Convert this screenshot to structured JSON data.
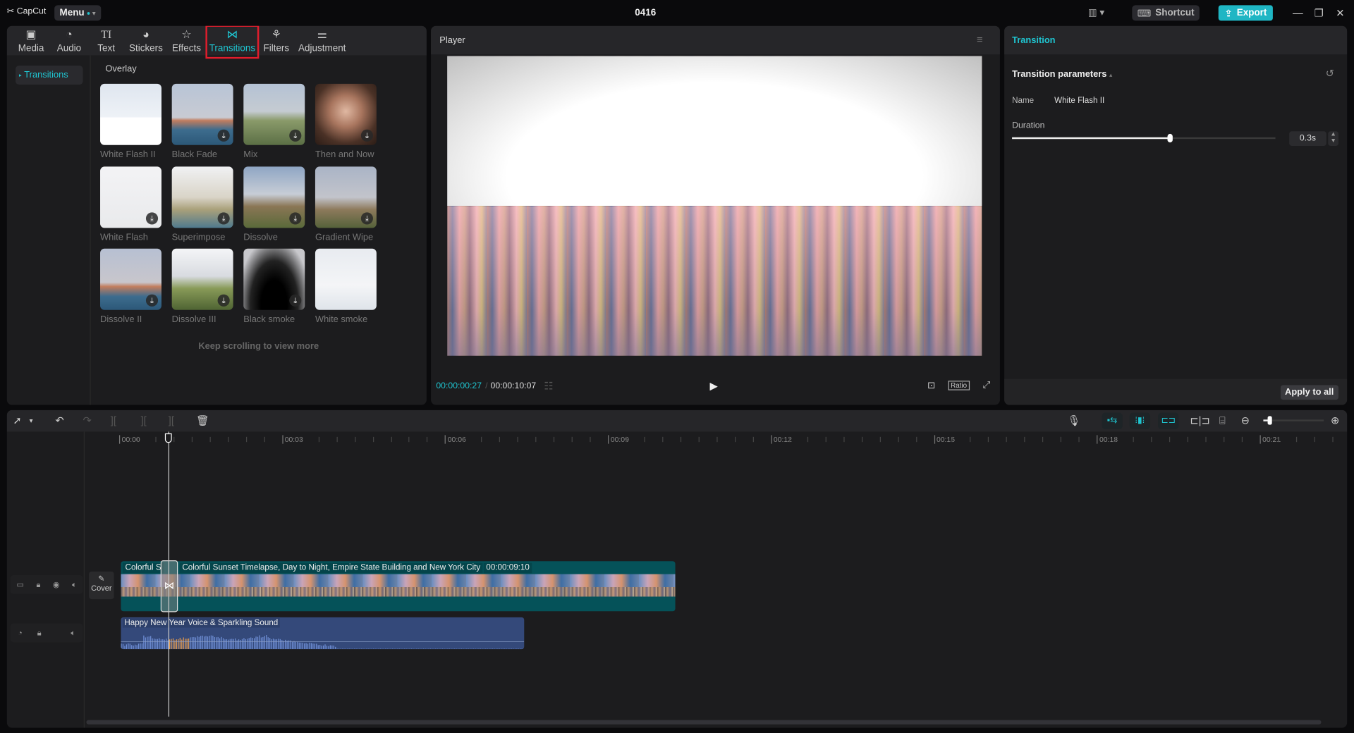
{
  "app": {
    "logo": "CapCut",
    "menu_label": "Menu",
    "project_title": "0416",
    "shortcut_label": "Shortcut",
    "export_label": "Export",
    "window_controls": [
      "minimize-icon",
      "restore-icon",
      "close-icon"
    ]
  },
  "left_panel": {
    "tabs": [
      {
        "label": "Media",
        "icon": "media-icon"
      },
      {
        "label": "Audio",
        "icon": "audio-icon"
      },
      {
        "label": "Text",
        "icon": "text-icon"
      },
      {
        "label": "Stickers",
        "icon": "stickers-icon"
      },
      {
        "label": "Effects",
        "icon": "effects-icon"
      },
      {
        "label": "Transitions",
        "icon": "transitions-icon",
        "active": true
      },
      {
        "label": "Filters",
        "icon": "filters-icon"
      },
      {
        "label": "Adjustment",
        "icon": "adjustment-icon"
      }
    ],
    "sidenav": [
      "Transitions"
    ],
    "section_title": "Overlay",
    "items": [
      {
        "label": "White Flash II",
        "download": false
      },
      {
        "label": "Black Fade",
        "download": true
      },
      {
        "label": "Mix",
        "download": true
      },
      {
        "label": "Then and Now",
        "download": true
      },
      {
        "label": "White Flash",
        "download": true
      },
      {
        "label": "Superimpose",
        "download": true
      },
      {
        "label": "Dissolve",
        "download": true
      },
      {
        "label": "Gradient Wipe",
        "download": true
      },
      {
        "label": "Dissolve II",
        "download": true
      },
      {
        "label": "Dissolve III",
        "download": true
      },
      {
        "label": "Black smoke",
        "download": true
      },
      {
        "label": "White smoke",
        "download": false
      }
    ],
    "keep_scrolling": "Keep scrolling to view more"
  },
  "player": {
    "title": "Player",
    "current_time": "00:00:00:27",
    "separator": "/",
    "total_time": "00:00:10:07",
    "ratio_label": "Ratio"
  },
  "right_panel": {
    "title": "Transition",
    "section": "Transition parameters",
    "name_label": "Name",
    "name_value": "White Flash II",
    "duration_label": "Duration",
    "duration_value": "0.3s",
    "duration_slider_fraction": 0.6,
    "apply_all_label": "Apply to all"
  },
  "timeline": {
    "ruler_labels": [
      "00:00",
      "00:03",
      "00:06",
      "00:09",
      "00:12",
      "00:15",
      "00:18",
      "00:21"
    ],
    "cover_label": "Cover",
    "video_clip": {
      "short_title": "Colorful S",
      "title": "Colorful Sunset Timelapse, Day to Night, Empire State Building and New York City",
      "duration": "00:00:09:10"
    },
    "audio_clip": {
      "title": "Happy New Year Voice & Sparkling Sound"
    },
    "zoom_fraction": 0.1
  }
}
